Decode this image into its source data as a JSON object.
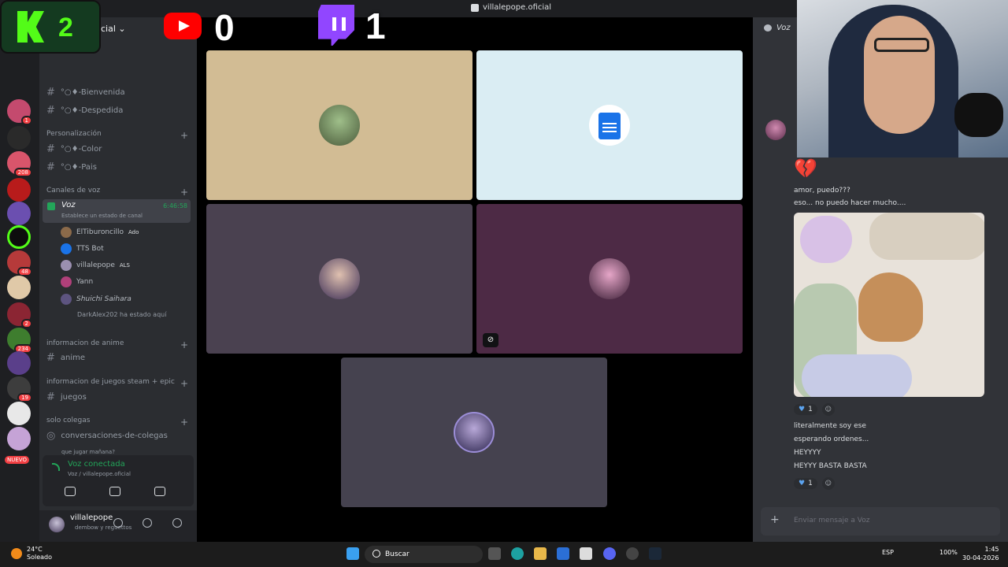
{
  "window": {
    "title": "villalepope.oficial"
  },
  "overlays": {
    "kick_count": "2",
    "youtube_count": "0",
    "twitch_count": "1"
  },
  "server": {
    "name": "cial"
  },
  "sidebar": {
    "channels_top": [
      "°○♦-Bienvenida",
      "°○♦-Despedida"
    ],
    "categories": {
      "personalizacion": "Personalización",
      "canales_voz": "Canales de voz",
      "info_anime": "informacion de anime",
      "info_juegos": "informacion de juegos steam + epic",
      "solo_colegas": "solo colegas"
    },
    "personalizacion_channels": [
      "°○♦-Color",
      "°○♦-Pais"
    ],
    "voice_channel": {
      "name": "Voz",
      "time": "6:46:58",
      "status": "Establece un estado de canal"
    },
    "voice_users": [
      {
        "name": "ElTiburoncillo",
        "tag": "Ado"
      },
      {
        "name": "TTS Bot",
        "tag": ""
      },
      {
        "name": "villalepope",
        "tag": "ALS"
      },
      {
        "name": "Yann",
        "tag": ""
      },
      {
        "name": "Shuichi Saihara",
        "tag": ""
      },
      {
        "name": "DarkAlex202 ha estado aquí",
        "tag": ""
      }
    ],
    "anime_channel": "anime",
    "juegos_channel": "juegos",
    "colegas_channel": "conversaciones-de-colegas",
    "colegas_sub": "que jugar mañana?"
  },
  "server_badges": [
    "1",
    "208",
    "48",
    "2",
    "234",
    "19"
  ],
  "new_badge": "NUEVO",
  "voice_panel": {
    "status": "Voz conectada",
    "sub": "Voz / villalepope.oficial"
  },
  "user_panel": {
    "name": "villalepope",
    "status": "dembow y reguettos"
  },
  "chat": {
    "header": "Voz",
    "messages": [
      "amor, puedo???",
      "eso... no puedo hacer mucho...."
    ],
    "messages2": [
      "literalmente soy ese",
      "esperando ordenes...",
      "HEYYYY",
      "HEYYY BASTA BASTA"
    ],
    "reaction_count_1": "1",
    "reaction_count_2": "1",
    "input_placeholder": "Enviar mensaje a Voz"
  },
  "taskbar": {
    "weather_temp": "24°C",
    "weather_desc": "Soleado",
    "search": "Buscar",
    "lang": "ESP",
    "battery": "100%",
    "time": "1:45",
    "date": "30-04-2026"
  },
  "colors": {
    "tile_1": "#d2bc94",
    "tile_2": "#daedf3",
    "tile_3": "#4a4150",
    "tile_4": "#4d2a45",
    "tile_5": "#45424f",
    "accent_green": "#23a559"
  }
}
